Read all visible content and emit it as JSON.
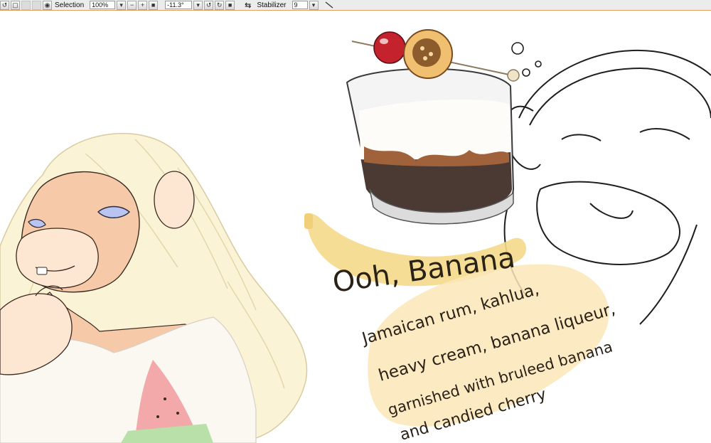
{
  "toolbar": {
    "selection_label": "Selection",
    "zoom_value": "100%",
    "rotation_value": "-11.3°",
    "stabilizer_label": "Stabilizer",
    "stabilizer_value": "9"
  },
  "artwork": {
    "title_text": "Ooh, Banana",
    "recipe_lines": [
      "Jamaican rum, kahlua,",
      "heavy cream, banana liqueur,",
      "garnished with bruleed banana",
      "and candied cherry"
    ],
    "colors": {
      "banana_yellow": "#f5d98a",
      "highlight_cream": "#fbe6b8",
      "coffee": "#4a3a33",
      "cherry": "#c4232e",
      "skin": "#f6c9a8",
      "hair": "#fbf3d6"
    }
  }
}
